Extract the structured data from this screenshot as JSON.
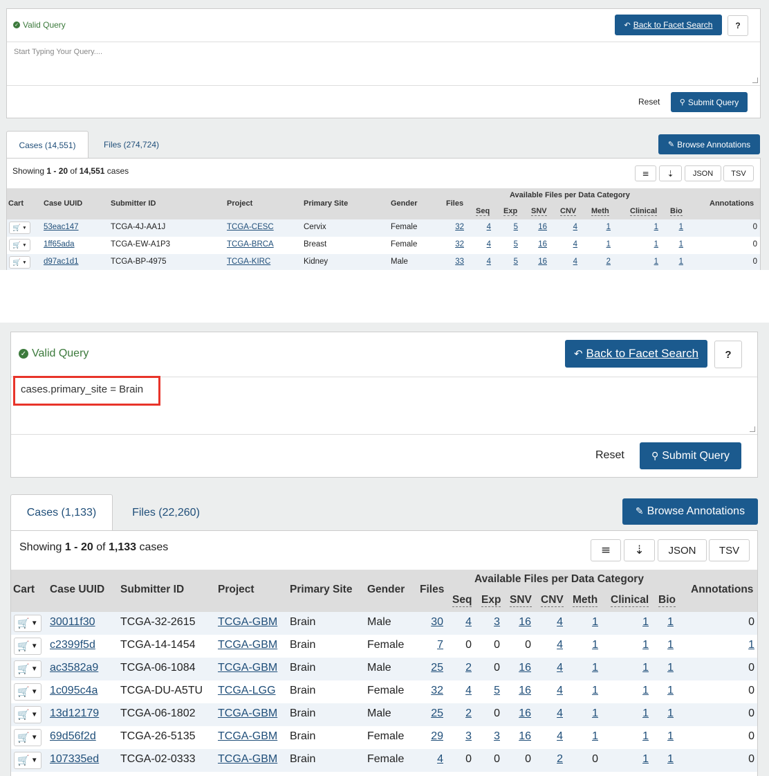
{
  "top": {
    "status": "Valid Query",
    "back_button": "Back to Facet Search",
    "help_button": "?",
    "query_placeholder": "Start Typing Your Query....",
    "reset": "Reset",
    "submit": "Submit Query",
    "tabs": [
      "Cases (14,551)",
      "Files (274,724)"
    ],
    "browse": "Browse Annotations",
    "showing": {
      "prefix": "Showing ",
      "range": "1 - 20",
      "of": " of ",
      "total": "14,551",
      "suffix": " cases"
    },
    "tools": {
      "json": "JSON",
      "tsv": "TSV"
    },
    "columns": {
      "cart": "Cart",
      "uuid": "Case UUID",
      "submitter": "Submitter ID",
      "project": "Project",
      "site": "Primary Site",
      "gender": "Gender",
      "files": "Files",
      "group": "Available Files per Data Category",
      "seq": "Seq",
      "exp": "Exp",
      "snv": "SNV",
      "cnv": "CNV",
      "meth": "Meth",
      "clinical": "Clinical",
      "bio": "Bio",
      "annotations": "Annotations"
    },
    "rows": [
      {
        "uuid": "53eac147",
        "submitter": "TCGA-4J-AA1J",
        "project": "TCGA-CESC",
        "site": "Cervix",
        "gender": "Female",
        "files": "32",
        "seq": "4",
        "exp": "5",
        "snv": "16",
        "cnv": "4",
        "meth": "1",
        "clinical": "1",
        "bio": "1",
        "annotations": "0"
      },
      {
        "uuid": "1ff65ada",
        "submitter": "TCGA-EW-A1P3",
        "project": "TCGA-BRCA",
        "site": "Breast",
        "gender": "Female",
        "files": "32",
        "seq": "4",
        "exp": "5",
        "snv": "16",
        "cnv": "4",
        "meth": "1",
        "clinical": "1",
        "bio": "1",
        "annotations": "0"
      },
      {
        "uuid": "d97ac1d1",
        "submitter": "TCGA-BP-4975",
        "project": "TCGA-KIRC",
        "site": "Kidney",
        "gender": "Male",
        "files": "33",
        "seq": "4",
        "exp": "5",
        "snv": "16",
        "cnv": "4",
        "meth": "2",
        "clinical": "1",
        "bio": "1",
        "annotations": "0"
      }
    ]
  },
  "bottom": {
    "status": "Valid Query",
    "back_button": "Back to Facet Search",
    "help_button": "?",
    "query_value": "cases.primary_site = Brain",
    "reset": "Reset",
    "submit": "Submit Query",
    "tabs": [
      "Cases (1,133)",
      "Files (22,260)"
    ],
    "browse": "Browse Annotations",
    "showing": {
      "prefix": "Showing ",
      "range": "1 - 20",
      "of": " of ",
      "total": "1,133",
      "suffix": " cases"
    },
    "tools": {
      "json": "JSON",
      "tsv": "TSV"
    },
    "columns": {
      "cart": "Cart",
      "uuid": "Case UUID",
      "submitter": "Submitter ID",
      "project": "Project",
      "site": "Primary Site",
      "gender": "Gender",
      "files": "Files",
      "group": "Available Files per Data Category",
      "seq": "Seq",
      "exp": "Exp",
      "snv": "SNV",
      "cnv": "CNV",
      "meth": "Meth",
      "clinical": "Clinical",
      "bio": "Bio",
      "annotations": "Annotations"
    },
    "rows": [
      {
        "uuid": "30011f30",
        "submitter": "TCGA-32-2615",
        "project": "TCGA-GBM",
        "site": "Brain",
        "gender": "Male",
        "files": "30",
        "seq": "4",
        "exp": "3",
        "snv": "16",
        "cnv": "4",
        "meth": "1",
        "clinical": "1",
        "bio": "1",
        "annotations": "0"
      },
      {
        "uuid": "c2399f5d",
        "submitter": "TCGA-14-1454",
        "project": "TCGA-GBM",
        "site": "Brain",
        "gender": "Female",
        "files": "7",
        "seq": "0",
        "exp": "0",
        "snv": "0",
        "cnv": "4",
        "meth": "1",
        "clinical": "1",
        "bio": "1",
        "annotations": "1"
      },
      {
        "uuid": "ac3582a9",
        "submitter": "TCGA-06-1084",
        "project": "TCGA-GBM",
        "site": "Brain",
        "gender": "Male",
        "files": "25",
        "seq": "2",
        "exp": "0",
        "snv": "16",
        "cnv": "4",
        "meth": "1",
        "clinical": "1",
        "bio": "1",
        "annotations": "0"
      },
      {
        "uuid": "1c095c4a",
        "submitter": "TCGA-DU-A5TU",
        "project": "TCGA-LGG",
        "site": "Brain",
        "gender": "Female",
        "files": "32",
        "seq": "4",
        "exp": "5",
        "snv": "16",
        "cnv": "4",
        "meth": "1",
        "clinical": "1",
        "bio": "1",
        "annotations": "0"
      },
      {
        "uuid": "13d12179",
        "submitter": "TCGA-06-1802",
        "project": "TCGA-GBM",
        "site": "Brain",
        "gender": "Male",
        "files": "25",
        "seq": "2",
        "exp": "0",
        "snv": "16",
        "cnv": "4",
        "meth": "1",
        "clinical": "1",
        "bio": "1",
        "annotations": "0"
      },
      {
        "uuid": "69d56f2d",
        "submitter": "TCGA-26-5135",
        "project": "TCGA-GBM",
        "site": "Brain",
        "gender": "Female",
        "files": "29",
        "seq": "3",
        "exp": "3",
        "snv": "16",
        "cnv": "4",
        "meth": "1",
        "clinical": "1",
        "bio": "1",
        "annotations": "0"
      },
      {
        "uuid": "107335ed",
        "submitter": "TCGA-02-0333",
        "project": "TCGA-GBM",
        "site": "Brain",
        "gender": "Female",
        "files": "4",
        "seq": "0",
        "exp": "0",
        "snv": "0",
        "cnv": "2",
        "meth": "0",
        "clinical": "1",
        "bio": "1",
        "annotations": "0"
      }
    ]
  }
}
